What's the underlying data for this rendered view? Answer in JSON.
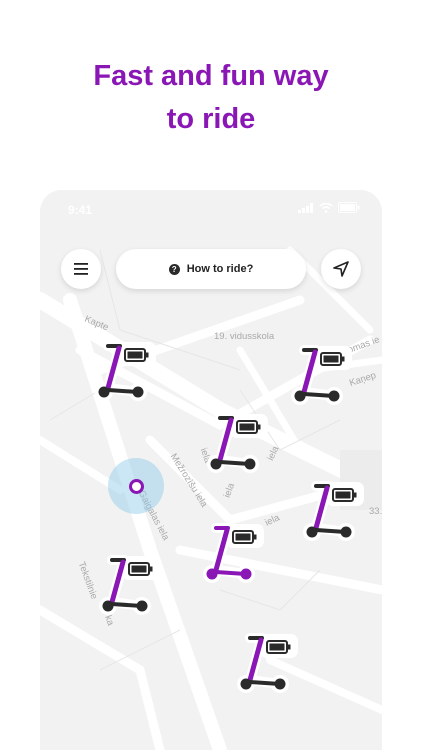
{
  "headline": {
    "line1": "Fast and fun way",
    "line2": "to ride"
  },
  "status_bar": {
    "time": "9:41"
  },
  "map": {
    "labels": {
      "kaptes": "Kaptе",
      "school": "19. vidusskola",
      "jomas": "jomas ie",
      "kanep": "Kaņep",
      "iela_left": "iela",
      "mezrozu": "Mežrozīšu iela",
      "iela_small": "iela",
      "iela_right": "iela",
      "gaigalas": "Gaigalas iela",
      "number_33": "33.",
      "tekstilnie": "Tekstilnie",
      "ka": "ka"
    }
  },
  "toolbar": {
    "how_to_ride": "How to ride?",
    "help_glyph": "?"
  },
  "colors": {
    "brand": "#8a17b5",
    "scooter": "#2a2a2a"
  },
  "icons": {
    "menu": "menu-icon",
    "location": "navigation-arrow-icon",
    "battery": "battery-icon",
    "scooter": "scooter-icon"
  },
  "scooters": [
    {
      "id": "scooter-1",
      "selected": false
    },
    {
      "id": "scooter-2",
      "selected": false
    },
    {
      "id": "scooter-3",
      "selected": false
    },
    {
      "id": "scooter-4",
      "selected": false
    },
    {
      "id": "scooter-5",
      "selected": true
    },
    {
      "id": "scooter-6",
      "selected": false
    },
    {
      "id": "scooter-7",
      "selected": false
    }
  ]
}
